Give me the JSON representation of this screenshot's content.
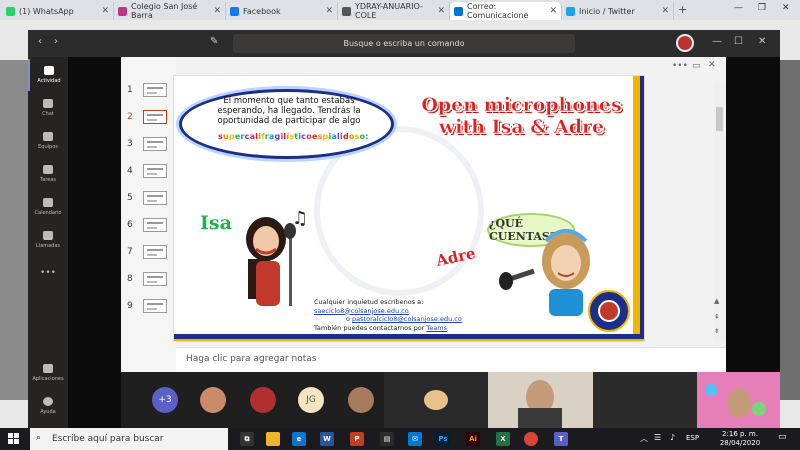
{
  "browser": {
    "tabs": [
      {
        "label": "(1) WhatsApp",
        "favicon_color": "#25d366"
      },
      {
        "label": "Colegio San José Barra",
        "favicon_color": "#c13584"
      },
      {
        "label": "Facebook",
        "favicon_color": "#1877f2"
      },
      {
        "label": "YDRAY-ANUARIO-COLE",
        "favicon_color": "#555555"
      },
      {
        "label": "Correo: Comunicacione",
        "favicon_color": "#0078d4"
      },
      {
        "label": "Inicio / Twitter",
        "favicon_color": "#1da1f2"
      }
    ],
    "new_tab": "+",
    "window_controls": [
      "—",
      "❐",
      "✕"
    ]
  },
  "teams": {
    "search_placeholder": "Busque o escriba un comando",
    "rail": [
      {
        "label": "Actividad",
        "active": true
      },
      {
        "label": "Chat"
      },
      {
        "label": "Equipos"
      },
      {
        "label": "Tareas"
      },
      {
        "label": "Calendario"
      },
      {
        "label": "Llamadas"
      },
      {
        "label": "•••"
      },
      {
        "label": "Aplicaciones"
      },
      {
        "label": "Ayuda"
      }
    ],
    "slide_numbers": [
      "1",
      "2",
      "3",
      "4",
      "5",
      "6",
      "7",
      "8",
      "9"
    ],
    "selected_slide": "2",
    "notes_placeholder": "Haga clic para agregar notas",
    "slide": {
      "bubble_text": "El momento que tanto estabas esperando, ha llegado. Tendrás la oportunidad de participar de algo",
      "bubble_rainbow": "supercalifragilísticoespialidoso:",
      "title": "Open microphones with Isa & Adre",
      "isa": "Isa",
      "adre": "Adre",
      "question": "¿QUÉ CUENTAS?",
      "contact_line1": "Cualquier inquietud escríbenos a: ",
      "email1": "saeciclo8@colsanjose.edu.co",
      "contact_line2": "o ",
      "email2": "pastoralciclo8@colsanjose.edu.co",
      "contact_line3": "También puedes contactarnos por ",
      "teams_link": "Teams"
    },
    "call": {
      "overflow_count": "+3",
      "initials": "JG"
    }
  },
  "taskbar": {
    "search_placeholder": "Escribe aquí para buscar",
    "time": "2:16 p. m.",
    "date": "28/04/2020",
    "lang": "ESP"
  }
}
